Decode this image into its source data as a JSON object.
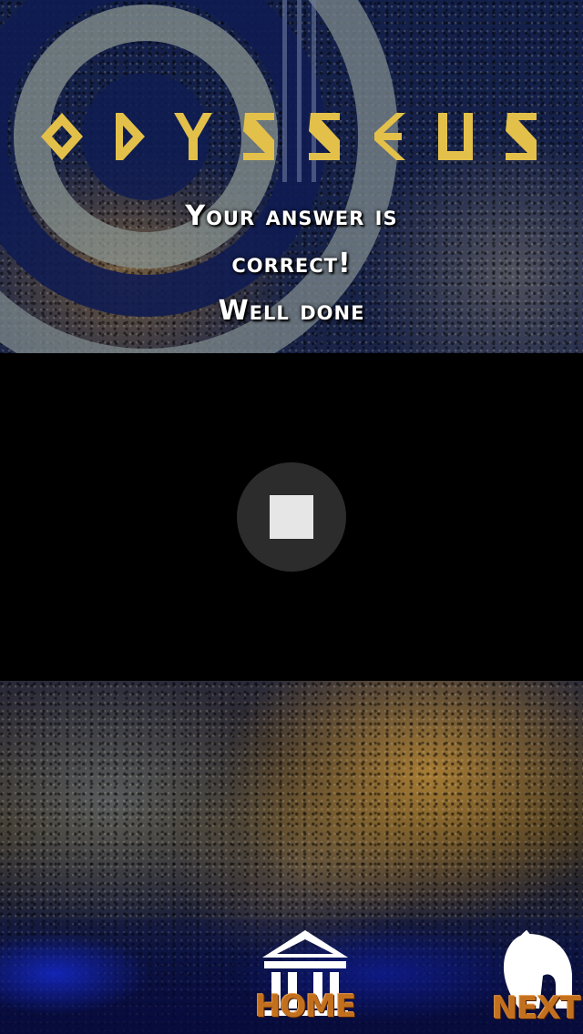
{
  "app": {
    "title_letters": [
      "O",
      "D",
      "Y",
      "S",
      "S",
      "E",
      "U",
      "S"
    ]
  },
  "result": {
    "line1": "Your answer is",
    "line2": "correct!",
    "line3": "Well done"
  },
  "video": {
    "control_icon": "stop-icon"
  },
  "nav": {
    "home_label": "HOME",
    "home_icon": "temple-icon",
    "next_label": "NEXT",
    "next_icon": "spartan-helmet-icon"
  },
  "colors": {
    "title_gold": "#e3c04a",
    "nav_label": "#c3701e"
  }
}
